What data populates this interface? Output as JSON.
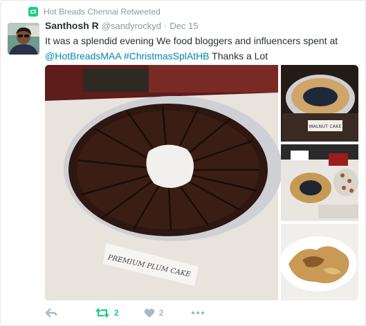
{
  "retweet_context": {
    "text": "Hot Breads Chennai Retweeted",
    "icon": "retweet-icon"
  },
  "tweet": {
    "display_name": "Santhosh R",
    "handle": "@sandyrockyd",
    "separator": "·",
    "timestamp": "Dec 15",
    "text_line1": "It was a splendid evening We food bloggers and influencers spent at",
    "mention": "@HotBreadsMAA",
    "hashtag": "#ChristmasSplAtHB",
    "text_end": "Thanks a Lot"
  },
  "media": {
    "main_label": "PREMIUM PLUM CAKE",
    "thumb1_label": "WALNUT CAKE"
  },
  "actions": {
    "reply_icon": "reply-icon",
    "retweet_icon": "retweet-icon",
    "retweet_count": "2",
    "like_icon": "heart-icon",
    "like_count": "2",
    "more_icon": "more-icon"
  },
  "colors": {
    "retweet_green": "#19cf86",
    "link_blue": "#0084b4",
    "muted": "#8899a6",
    "text": "#292f33",
    "like_icon": "#aab8c2"
  }
}
